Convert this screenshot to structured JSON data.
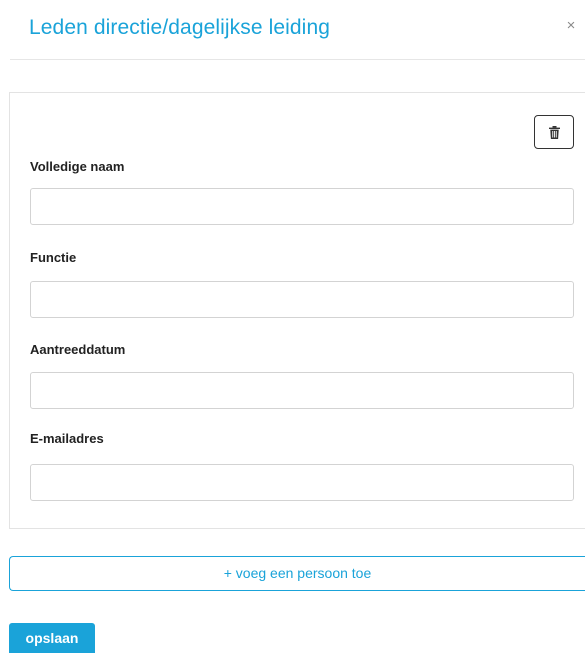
{
  "modal": {
    "title": "Leden directie/dagelijkse leiding",
    "close_glyph": "×",
    "close_icon": "close-icon"
  },
  "person_card": {
    "delete_icon": "trash-icon",
    "fields": [
      {
        "label": "Volledige naam",
        "value": "",
        "placeholder": ""
      },
      {
        "label": "Functie",
        "value": "",
        "placeholder": ""
      },
      {
        "label": "Aantreeddatum",
        "value": "",
        "placeholder": ""
      },
      {
        "label": "E-mailadres",
        "value": "",
        "placeholder": ""
      }
    ]
  },
  "actions": {
    "add_person_label": "+ voeg een persoon toe",
    "save_label": "opslaan"
  },
  "colors": {
    "accent": "#1aa3d9",
    "label_text": "#222222",
    "border": "#d3d3d3"
  }
}
